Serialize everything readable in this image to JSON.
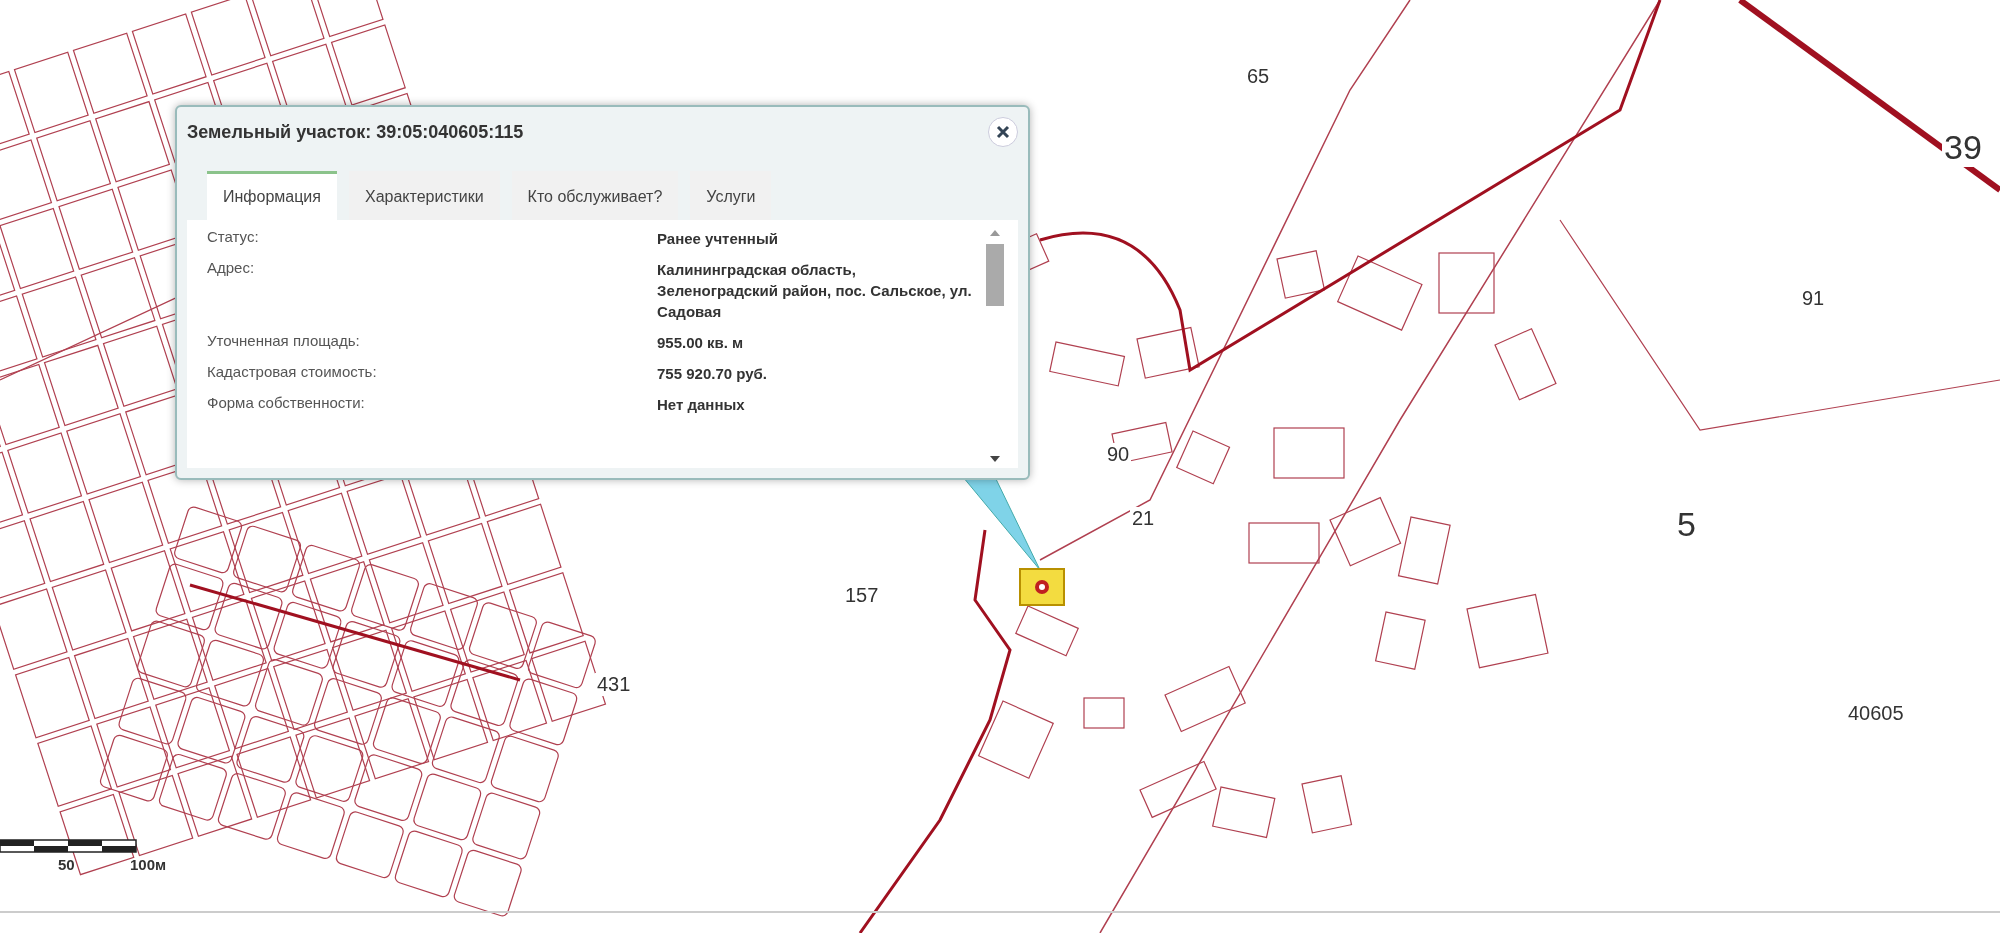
{
  "map_labels": [
    "39",
    "5",
    "40605",
    "431",
    "157",
    "91",
    "65",
    "90",
    "21"
  ],
  "scale_bar": {
    "labels": [
      "50",
      "100м"
    ]
  },
  "popup": {
    "title": "Земельный участок: 39:05:040605:115",
    "tabs": [
      {
        "label": "Информация",
        "selected": true
      },
      {
        "label": "Характеристики",
        "selected": false
      },
      {
        "label": "Кто обслуживает?",
        "selected": false
      },
      {
        "label": "Услуги",
        "selected": false
      }
    ],
    "rows": [
      {
        "label": "Статус:",
        "value": "Ранее учтенный"
      },
      {
        "label": "Адрес:",
        "value": "Калининградская область, Зеленоградский район, пос. Сальское, ул. Садовая"
      },
      {
        "label": "Уточненная площадь:",
        "value": "955.00 кв. м"
      },
      {
        "label": "Кадастровая стоимость:",
        "value": "755 920.70 руб."
      },
      {
        "label": "Форма собственности:",
        "value": "Нет данных"
      }
    ]
  }
}
